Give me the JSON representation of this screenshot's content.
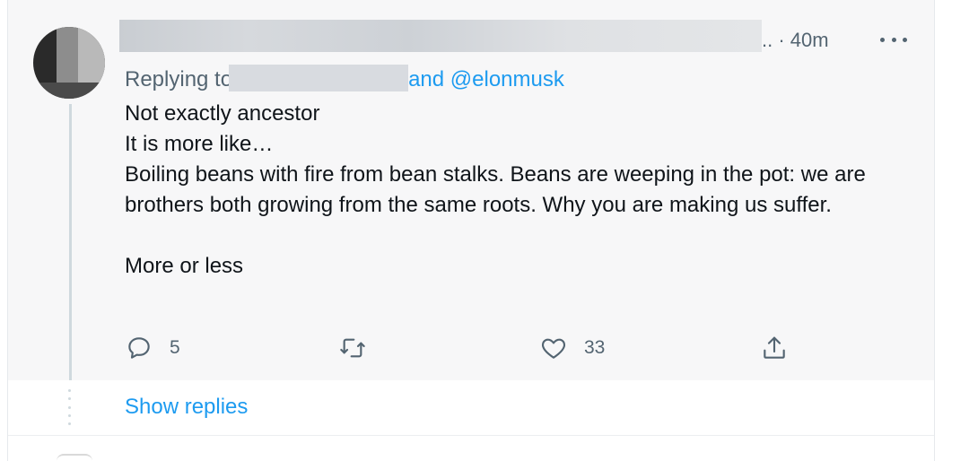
{
  "tweet": {
    "timestamp": "· 40m",
    "replying_prefix": "Replying to",
    "replying_suffix": "and @elonmusk",
    "body": [
      "Not exactly ancestor",
      "It is more like…",
      "Boiling beans with fire from bean stalks. Beans are weeping in the pot: we are brothers both growing from the same roots. Why you are making us suffer.",
      "",
      "More or less"
    ],
    "actions": {
      "reply_count": "5",
      "retweet_count": "",
      "like_count": "33"
    },
    "icons": [
      "more-icon",
      "reply-icon",
      "retweet-icon",
      "like-icon",
      "share-icon"
    ]
  },
  "thread": {
    "show_replies_label": "Show replies"
  },
  "colors": {
    "accent": "#1d9bf0",
    "secondary_text": "#536471",
    "tweet_bg": "#f7f7f8"
  }
}
